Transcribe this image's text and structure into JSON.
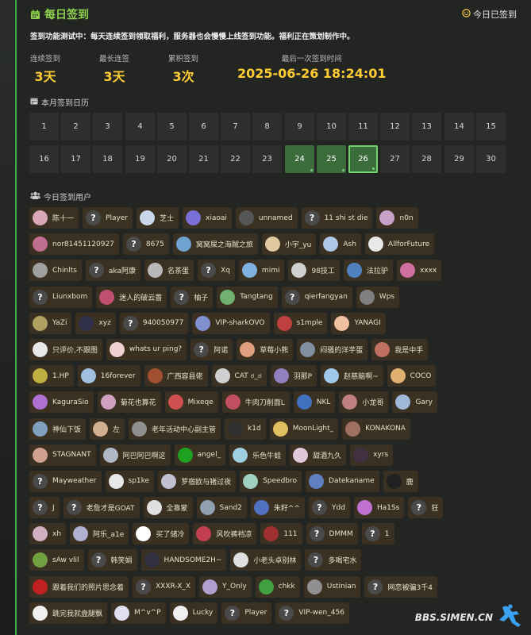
{
  "header": {
    "title": "每日签到",
    "today_status": "今日已签到"
  },
  "notice": "签到功能测试中：每天连续签到领取福利，服务器也会慢慢上线签到功能。福利正在策划制作中。",
  "stats": [
    {
      "label": "连续签到",
      "value": "3天"
    },
    {
      "label": "最长连签",
      "value": "3天"
    },
    {
      "label": "累积签到",
      "value": "3次"
    },
    {
      "label": "最后一次签到时间",
      "value": "2025-06-26 18:24:01"
    }
  ],
  "calendar": {
    "title": "本月签到日历",
    "days": [
      1,
      2,
      3,
      4,
      5,
      6,
      7,
      8,
      9,
      10,
      11,
      12,
      13,
      14,
      15,
      16,
      17,
      18,
      19,
      20,
      21,
      22,
      23,
      24,
      25,
      26,
      27,
      28,
      29,
      30
    ],
    "signed_days": [
      24,
      25,
      26
    ],
    "current_day": 26
  },
  "users_section": {
    "title": "今日签到用户"
  },
  "user_rows": [
    [
      {
        "name": "陈十一",
        "av": "#d9a7b8"
      },
      {
        "name": "Player",
        "av": "q"
      },
      {
        "name": "芝士",
        "av": "#c9d8e8"
      },
      {
        "name": "xiaoai",
        "av": "#7a6fd6"
      },
      {
        "name": "unnamed",
        "av": "#555"
      },
      {
        "name": "11 shi st die",
        "av": "q"
      },
      {
        "name": "n0n",
        "av": "#c9a0c8"
      }
    ],
    [
      {
        "name": "nor81451120927",
        "av": "#c06f90"
      },
      {
        "name": "8675",
        "av": "q"
      },
      {
        "name": "窝窝屎之海賊之旅",
        "av": "#6fa3d0"
      },
      {
        "name": "小宇_yu",
        "av": "#e0c8a0"
      },
      {
        "name": "Ash",
        "av": "#b0c8e8"
      },
      {
        "name": "AllforFuture",
        "av": "#e8e8e8"
      }
    ],
    [
      {
        "name": "Chinlts",
        "av": "#a0a0a0"
      },
      {
        "name": "aka阿康",
        "av": "q"
      },
      {
        "name": "名茶蛋",
        "av": "#b8b8b8"
      },
      {
        "name": "Xq",
        "av": "q"
      },
      {
        "name": "mimi",
        "av": "#7fb0e0"
      },
      {
        "name": "98技工",
        "av": "#d0d0d0"
      },
      {
        "name": "法拉驴",
        "av": "#5080c0"
      },
      {
        "name": "xxxx",
        "av": "#d070a0"
      }
    ],
    [
      {
        "name": "Liunxbom",
        "av": "q"
      },
      {
        "name": "迷人的破云蔷",
        "av": "#c05070"
      },
      {
        "name": "柚子",
        "av": "q"
      },
      {
        "name": "Tangtang",
        "av": "#70b070"
      },
      {
        "name": "qierfangyan",
        "av": "q"
      },
      {
        "name": "Wps",
        "av": "#808080"
      }
    ],
    [
      {
        "name": "YaZi",
        "av": "#b0a060"
      },
      {
        "name": "xyz",
        "av": "#303048"
      },
      {
        "name": "940050977",
        "av": "q"
      },
      {
        "name": "VIP-sharkOVO",
        "av": "#8090d0"
      },
      {
        "name": "s1mple",
        "av": "#c04040"
      },
      {
        "name": "YANAGI",
        "av": "#f0c0a0"
      }
    ],
    [
      {
        "name": "只评价,不跟图",
        "av": "#e8e8e8"
      },
      {
        "name": "whats ur ping?",
        "av": "#f0d0d0"
      },
      {
        "name": "阿诺",
        "av": "q"
      },
      {
        "name": "草莓小熊",
        "av": "#e0a080"
      },
      {
        "name": "闷骚的洋芋蛋",
        "av": "#8090a0"
      },
      {
        "name": "我是中手",
        "av": "#c07060"
      }
    ],
    [
      {
        "name": "1.HP",
        "av": "#c0b040"
      },
      {
        "name": "16forever",
        "av": "#a0c0e0"
      },
      {
        "name": "广西容县佬",
        "av": "#a05030"
      },
      {
        "name": "CAT ಠ_ಠ",
        "av": "#d0d0d0"
      },
      {
        "name": "羽那P",
        "av": "#9080c0"
      },
      {
        "name": "赵慈脑啊~",
        "av": "#a0c8e8"
      },
      {
        "name": "COCO",
        "av": "#e0b070"
      }
    ],
    [
      {
        "name": "KaguraSio",
        "av": "#b070d0"
      },
      {
        "name": "菊花也算花",
        "av": "#d0a0c0"
      },
      {
        "name": "Mixeqe",
        "av": "#d05050"
      },
      {
        "name": "牛肉刀削面L",
        "av": "#c05060"
      },
      {
        "name": "NKL",
        "av": "#4070c0"
      },
      {
        "name": "小龙哥",
        "av": "#c08080"
      },
      {
        "name": "Gary",
        "av": "#a0b8d8"
      }
    ],
    [
      {
        "name": "神仙下饭",
        "av": "#80a0c0"
      },
      {
        "name": "左",
        "av": "#d0b090"
      },
      {
        "name": "老年活动中心副主管",
        "av": "#909090"
      },
      {
        "name": "k1d",
        "av": "#303030"
      },
      {
        "name": "MoonLight_",
        "av": "#e0c060"
      },
      {
        "name": "KONAKONA",
        "av": "#a07060"
      }
    ],
    [
      {
        "name": "STAGNANT",
        "av": "#d0a090"
      },
      {
        "name": "阿巴阿巴啊这",
        "av": "#b0b8c8"
      },
      {
        "name": "angel_",
        "av": "#20a020"
      },
      {
        "name": "乐色牛蛙",
        "av": "#a0d0e0"
      },
      {
        "name": "甜酒九久",
        "av": "#e0c8d8"
      },
      {
        "name": "xyrs",
        "av": "#403040"
      }
    ],
    [
      {
        "name": "Mayweather",
        "av": "q"
      },
      {
        "name": "sp1ke",
        "av": "#e8e8e8"
      },
      {
        "name": "罗宿欧与猪过夜",
        "av": "#c0c0d0"
      },
      {
        "name": "Speedbro",
        "av": "#a0d0c0"
      },
      {
        "name": "Datekaname",
        "av": "#6080c0"
      },
      {
        "name": "鹿",
        "av": "#202020"
      }
    ],
    [
      {
        "name": "J",
        "av": "q"
      },
      {
        "name": "老詹才是GOAT",
        "av": "q"
      },
      {
        "name": "全靠蒙",
        "av": "#e0e0e0"
      },
      {
        "name": "Sand2",
        "av": "#90a0b0"
      },
      {
        "name": "朱籽^^",
        "av": "#5070c0"
      },
      {
        "name": "Ydd",
        "av": "q"
      },
      {
        "name": "Ha1Ss",
        "av": "#c070d0"
      },
      {
        "name": "狂",
        "av": "q"
      }
    ],
    [
      {
        "name": "xh",
        "av": "#d0b0c0"
      },
      {
        "name": "阿乐_a1e",
        "av": "#b0b0d0"
      },
      {
        "name": "买了储冷",
        "av": "#ffffff"
      },
      {
        "name": "风吹裤裆凉",
        "av": "#c04050"
      },
      {
        "name": "111",
        "av": "#a03030"
      },
      {
        "name": "DMMM",
        "av": "q"
      },
      {
        "name": "1",
        "av": "q"
      }
    ],
    [
      {
        "name": "sAw vlil",
        "av": "#70a040"
      },
      {
        "name": "韩笑娟",
        "av": "q"
      },
      {
        "name": "HANDSOME2H~",
        "av": "#303040"
      },
      {
        "name": "小老头卓别林",
        "av": "#e0e0e0"
      },
      {
        "name": "多喝宅水",
        "av": "q"
      }
    ],
    [
      {
        "name": "跟着我们的照片思念着",
        "av": "#c02020"
      },
      {
        "name": "XXXR-X_X",
        "av": "q"
      },
      {
        "name": "Y_Only",
        "av": "#b0a0d0"
      },
      {
        "name": "chkk",
        "av": "#40a040"
      },
      {
        "name": "Ustinian",
        "av": "#909090"
      },
      {
        "name": "网恋被骗3千4",
        "av": "q"
      }
    ],
    [
      {
        "name": "跳完我就盘腿飘",
        "av": "#f0f0f0"
      },
      {
        "name": "M^v^P",
        "av": "#e0e0f0"
      },
      {
        "name": "Lucky",
        "av": "#f0f0f0"
      },
      {
        "name": "Player",
        "av": "q"
      },
      {
        "name": "VIP-wen_456",
        "av": "q"
      }
    ]
  ],
  "watermark": "BBS.SIMEN.CN"
}
